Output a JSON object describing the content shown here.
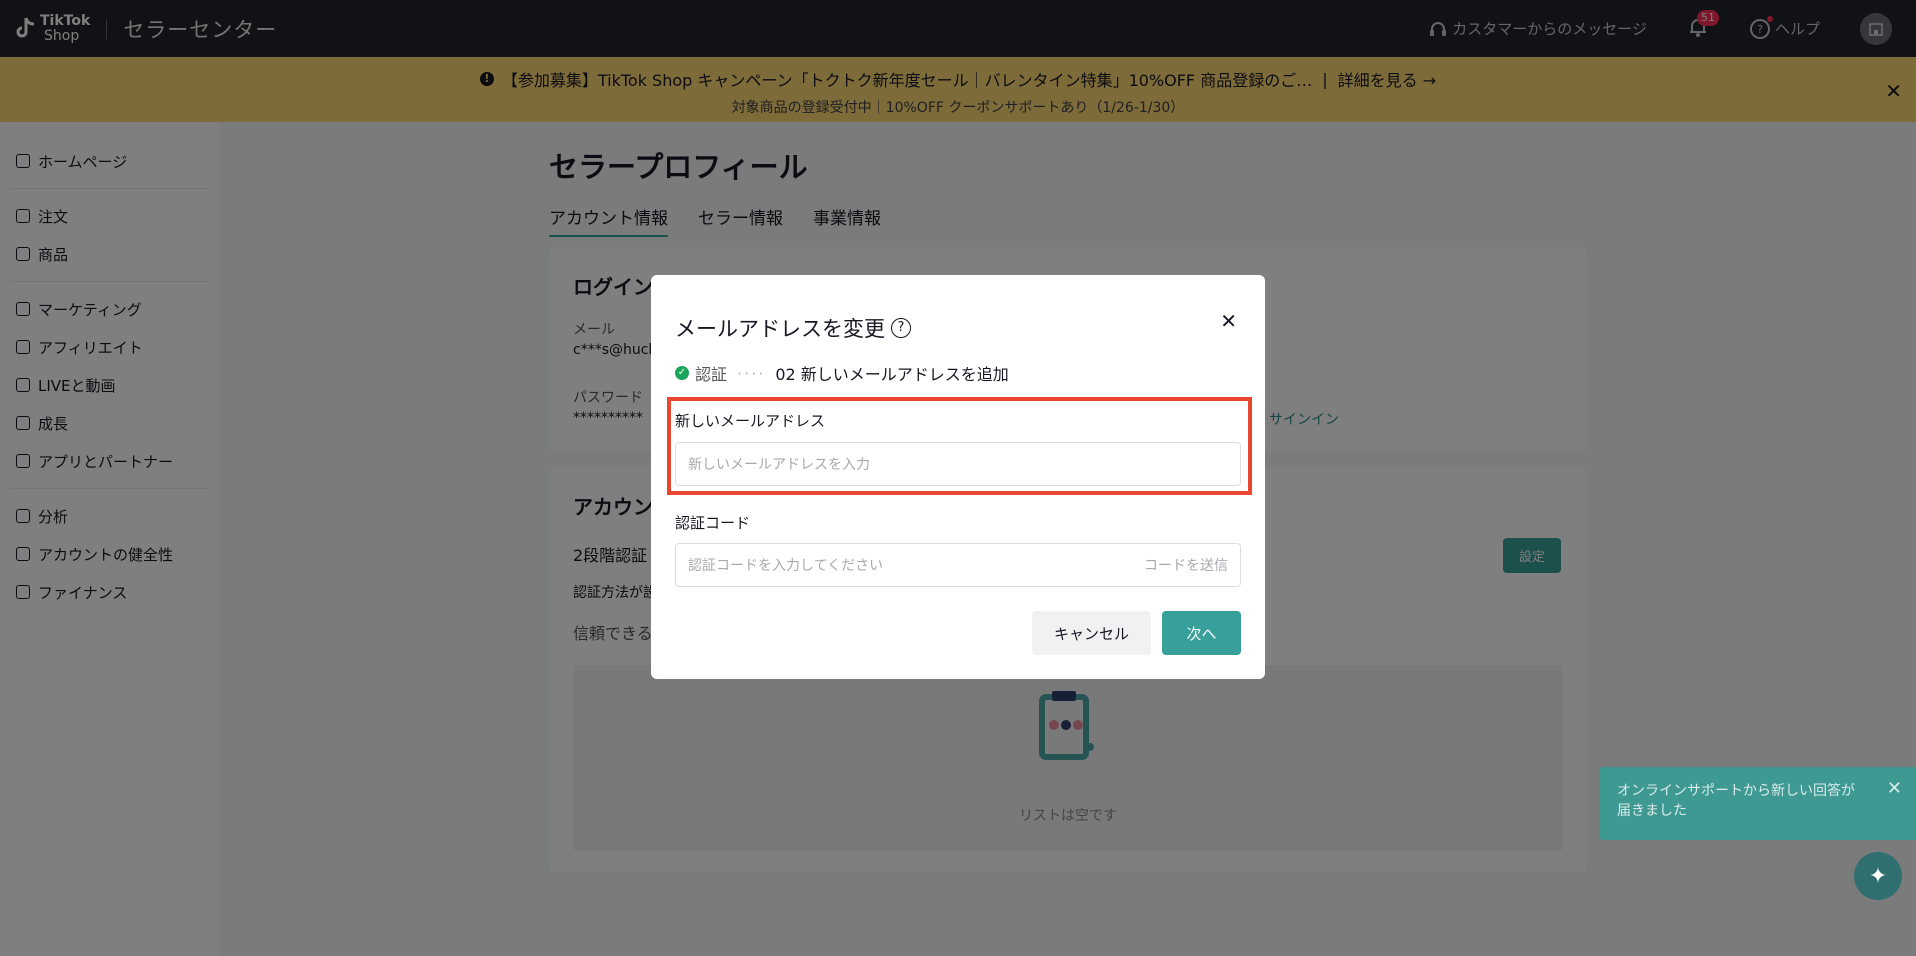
{
  "header": {
    "logo_text": "TikTok",
    "logo_sub": "Shop",
    "title": "セラーセンター",
    "messages_label": "カスタマーからのメッセージ",
    "notification_count": "51",
    "help_label": "ヘルプ"
  },
  "banner": {
    "line1": "【参加募集】TikTok Shop キャンペーン「トクトク新年度セール｜バレンタイン特集」10%OFF 商品登録のご…",
    "link": "詳細を見る →",
    "line2": "対象商品の登録受付中｜10%OFF クーポンサポートあり（1/26-1/30）"
  },
  "sidebar": {
    "items": [
      {
        "label": "ホームページ"
      },
      {
        "label": "注文"
      },
      {
        "label": "商品"
      },
      {
        "label": "マーケティング"
      },
      {
        "label": "アフィリエイト"
      },
      {
        "label": "LIVEと動画"
      },
      {
        "label": "成長"
      },
      {
        "label": "アプリとパートナー"
      },
      {
        "label": "分析"
      },
      {
        "label": "アカウントの健全性"
      },
      {
        "label": "ファイナンス"
      }
    ]
  },
  "page": {
    "title": "セラープロフィール",
    "tabs": [
      "アカウント情報",
      "セラー情報",
      "事業情報"
    ],
    "login_title": "ログイン",
    "email_label": "メール",
    "email_value": "c***s@huck",
    "password_label": "パスワード",
    "password_value": "**********",
    "signin_link": "サインイン",
    "account_title": "アカウン",
    "two_factor": "2段階認証",
    "auth_method": "認証方法が設",
    "trusted": "信頼できる",
    "set_button": "設定",
    "empty_text": "リストは空です"
  },
  "modal": {
    "title": "メールアドレスを変更",
    "step1": "認証",
    "step_dots": "····",
    "step2": "02 新しいメールアドレスを追加",
    "email_label": "新しいメールアドレス",
    "email_placeholder": "新しいメールアドレスを入力",
    "code_label": "認証コード",
    "code_placeholder": "認証コードを入力してください",
    "send_code": "コードを送信",
    "cancel": "キャンセル",
    "next": "次へ"
  },
  "toast": {
    "message": "オンラインサポートから新しい回答が届きました"
  },
  "colors": {
    "accent": "#37a09a",
    "banner": "#fdd774",
    "highlight": "#e9472f"
  }
}
